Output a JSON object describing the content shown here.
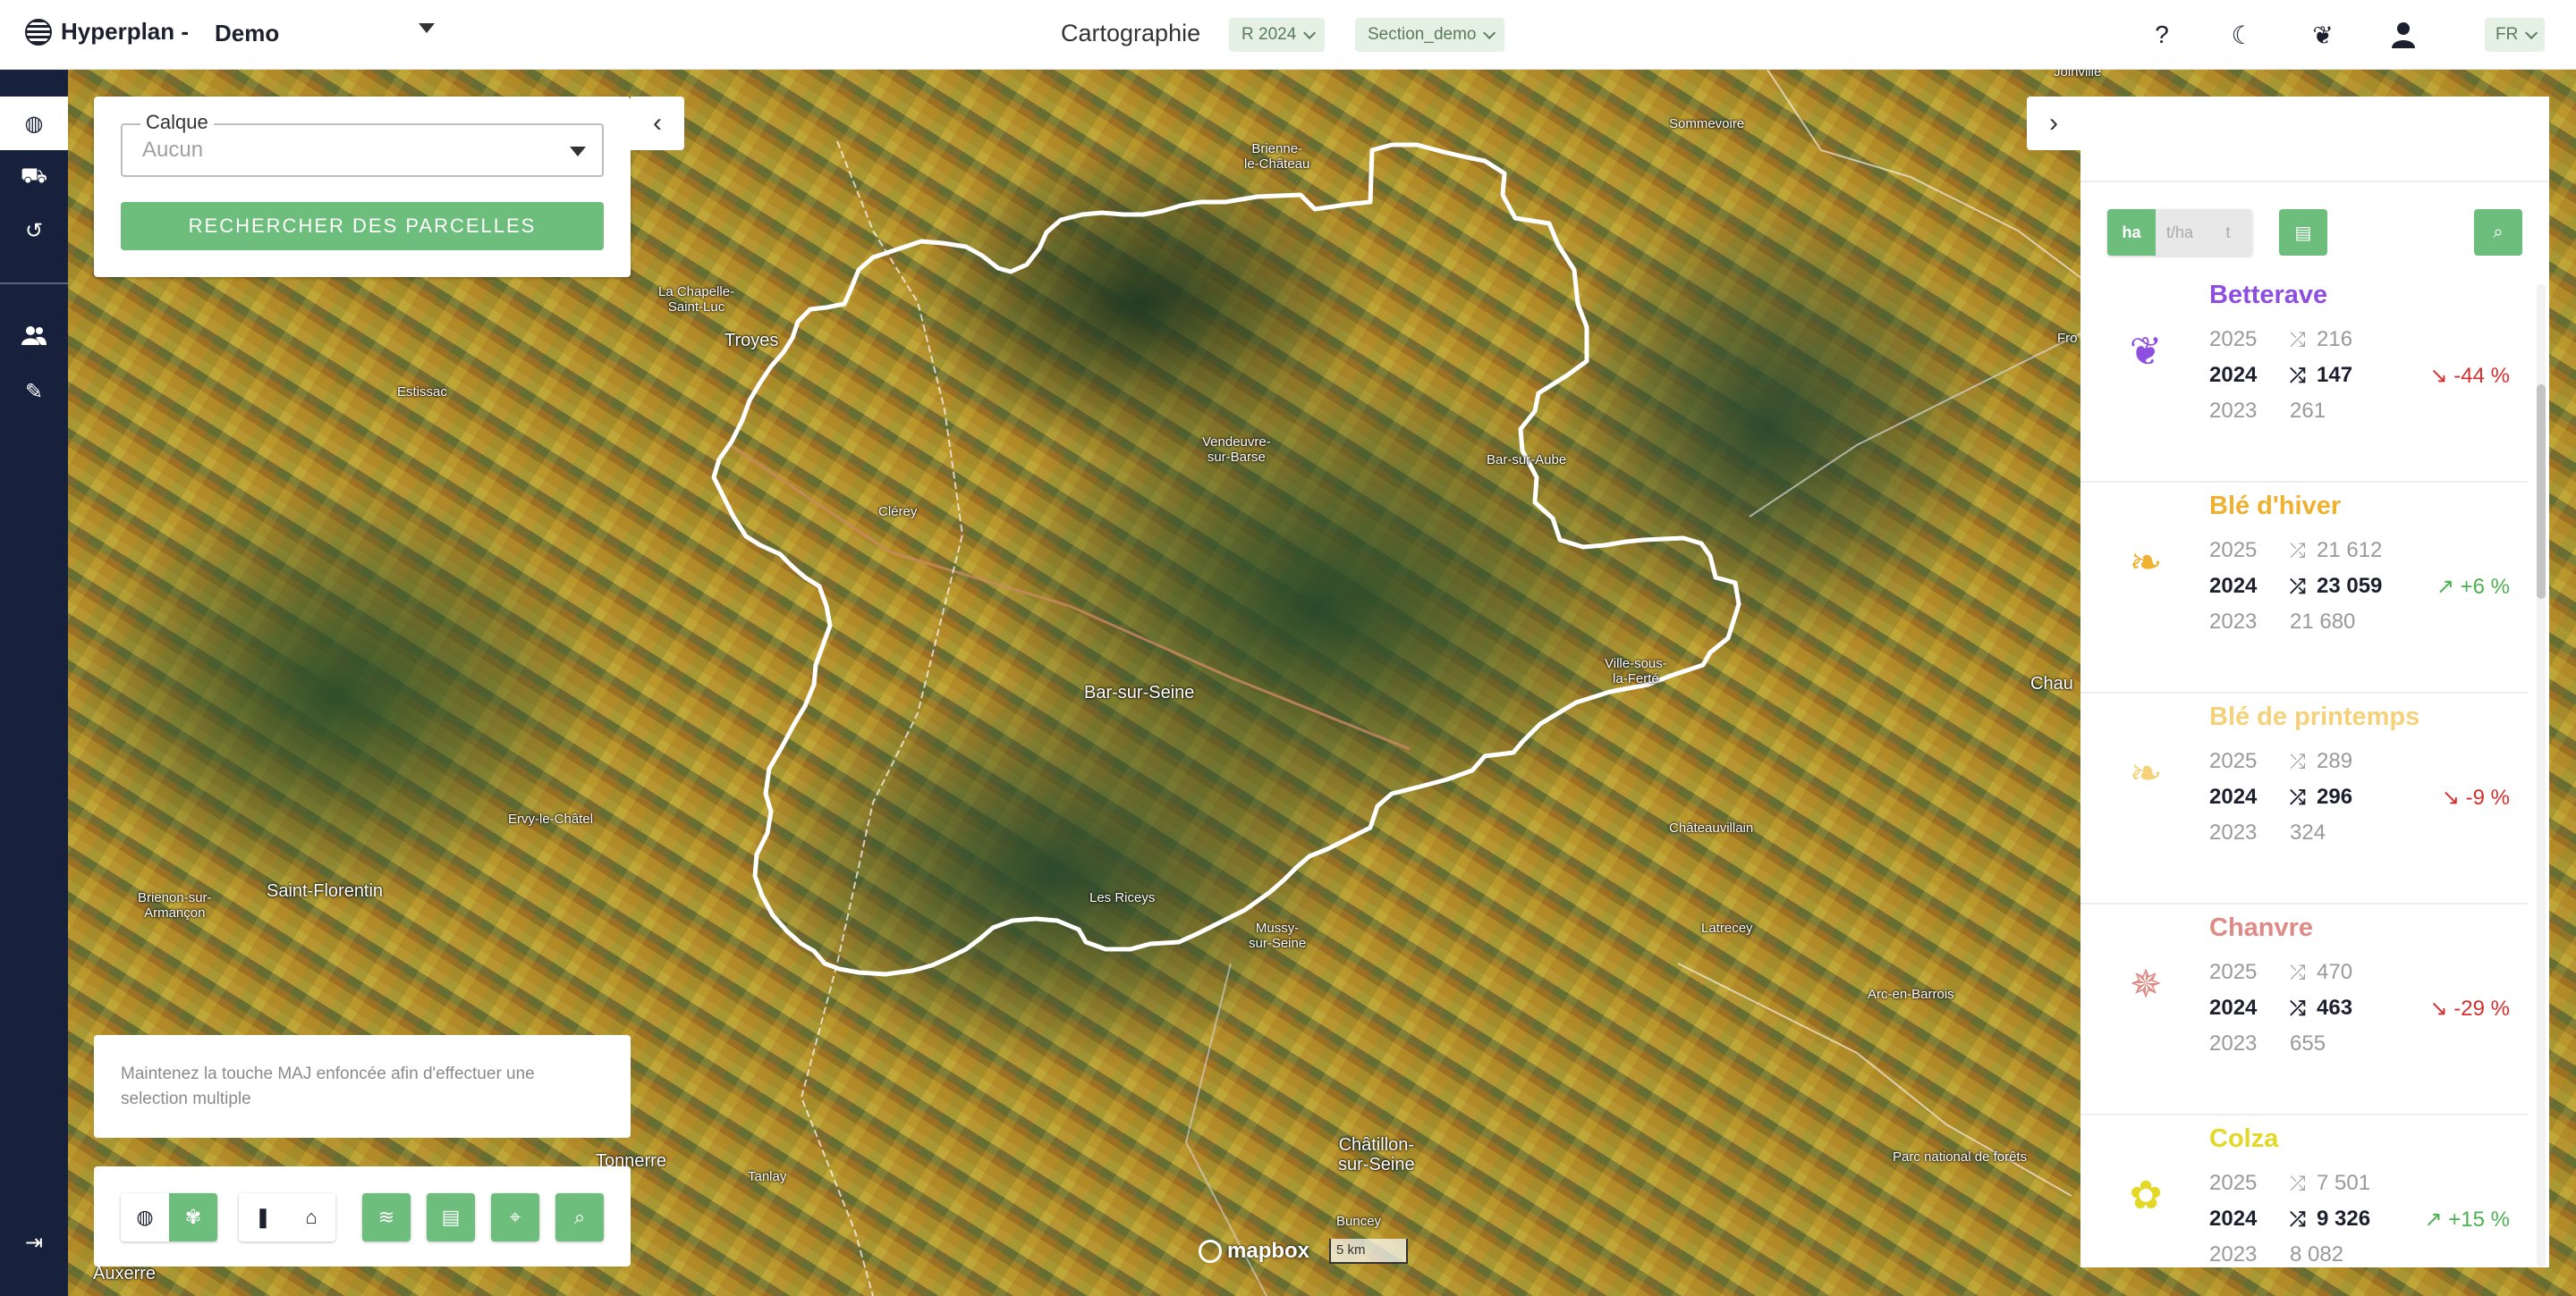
{
  "header": {
    "brand": "Hyperplan -",
    "project": "Demo",
    "title": "Cartographie",
    "chip_revision": "R 2024",
    "chip_section": "Section_demo",
    "help_icon": "?",
    "lang": "FR"
  },
  "map": {
    "places": [
      {
        "name": "Brienne-\nle-Château",
        "big": false
      },
      {
        "name": "Sommevoire",
        "big": false
      },
      {
        "name": "La Chapelle-\nSaint-Luc",
        "big": false
      },
      {
        "name": "Troyes",
        "big": true
      },
      {
        "name": "Estissac",
        "big": false
      },
      {
        "name": "Vendeuvre-\nsur-Barse",
        "big": false
      },
      {
        "name": "Bar-sur-Aube",
        "big": false
      },
      {
        "name": "Clérey",
        "big": false
      },
      {
        "name": "Ville-sous-\nla-Ferté",
        "big": false
      },
      {
        "name": "Bar-sur-Seine",
        "big": false
      },
      {
        "name": "Ervy-le-Châtel",
        "big": false
      },
      {
        "name": "Brienon-sur-\nArmançon",
        "big": false
      },
      {
        "name": "Saint-Florentin",
        "big": false
      },
      {
        "name": "Les Riceys",
        "big": false
      },
      {
        "name": "Mussy-\nsur-Seine",
        "big": false
      },
      {
        "name": "Châteauvillain",
        "big": false
      },
      {
        "name": "Latrecey",
        "big": false
      },
      {
        "name": "Arc-en-Barrois",
        "big": false
      },
      {
        "name": "Tonnerre",
        "big": false
      },
      {
        "name": "Tanlay",
        "big": false
      },
      {
        "name": "Châtillon-\nsur-Seine",
        "big": false
      },
      {
        "name": "Buncey",
        "big": false
      },
      {
        "name": "Parc national de forêts",
        "big": false
      },
      {
        "name": "Auxerre",
        "big": true
      },
      {
        "name": "Chau",
        "big": true
      },
      {
        "name": "Joinville",
        "big": false
      },
      {
        "name": "Fro",
        "big": false
      }
    ],
    "mapbox": "mapbox",
    "scale": "5 km"
  },
  "layer_panel": {
    "label": "Calque",
    "value": "Aucun",
    "search_button": "RECHERCHER DES PARCELLES"
  },
  "hint": "Maintenez la touche MAJ enfoncée afin d'effectuer une selection multiple",
  "right_panel": {
    "units": [
      "ha",
      "t/ha",
      "t"
    ],
    "crops": [
      {
        "name": "Betterave",
        "color": "#8e4ee0",
        "icon": "beet-icon",
        "glyph": "❦",
        "y2025": "2025",
        "v2025": "216",
        "y2024": "2024",
        "v2024": "147",
        "y2023": "2023",
        "v2023": "261",
        "trend": "-44 %",
        "dir": "down"
      },
      {
        "name": "Blé d'hiver",
        "color": "#efb12f",
        "icon": "wheat-icon",
        "glyph": "❧",
        "y2025": "2025",
        "v2025": "21 612",
        "y2024": "2024",
        "v2024": "23 059",
        "y2023": "2023",
        "v2023": "21 680",
        "trend": "+6 %",
        "dir": "up"
      },
      {
        "name": "Blé de printemps",
        "color": "#f5d27a",
        "icon": "spring-wheat-icon",
        "glyph": "❧",
        "y2025": "2025",
        "v2025": "289",
        "y2024": "2024",
        "v2024": "296",
        "y2023": "2023",
        "v2023": "324",
        "trend": "-9 %",
        "dir": "down"
      },
      {
        "name": "Chanvre",
        "color": "#df8a84",
        "icon": "hemp-icon",
        "glyph": "✵",
        "y2025": "2025",
        "v2025": "470",
        "y2024": "2024",
        "v2024": "463",
        "y2023": "2023",
        "v2023": "655",
        "trend": "-29 %",
        "dir": "down"
      },
      {
        "name": "Colza",
        "color": "#e3d825",
        "icon": "rapeseed-icon",
        "glyph": "✿",
        "y2025": "2025",
        "v2025": "7 501",
        "y2024": "2024",
        "v2024": "9 326",
        "y2023": "2023",
        "v2023": "8 082",
        "trend": "+15 %",
        "dir": "up"
      }
    ]
  }
}
